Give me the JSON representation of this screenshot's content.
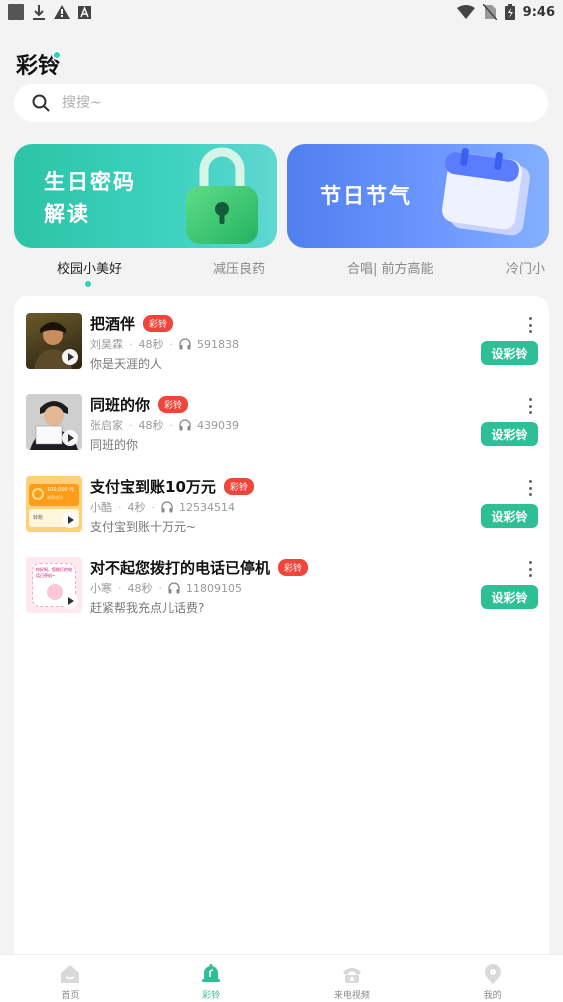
{
  "status_bar": {
    "time": "9:46",
    "left_icons": [
      "app-icon",
      "download-icon",
      "warning-icon",
      "a-icon"
    ],
    "right_icons": [
      "wifi-icon",
      "no-sim-icon",
      "battery-icon"
    ]
  },
  "header": {
    "title": "彩铃"
  },
  "search": {
    "placeholder": "搜搜~",
    "icon": "search-icon"
  },
  "banners": [
    {
      "text_line1": "生日密码",
      "text_line2": "解读",
      "icon": "lock-icon",
      "color": "#2cc4a6"
    },
    {
      "text_line1": "节日节气",
      "icon": "calendar-icon",
      "color": "#5a8df6"
    }
  ],
  "tabs": [
    {
      "label": "校园小美好",
      "active": true
    },
    {
      "label": "减压良药",
      "active": false
    },
    {
      "label": "合唱| 前方高能",
      "active": false
    },
    {
      "label": "冷门小",
      "active": false
    }
  ],
  "songs": [
    {
      "title": "把酒伴",
      "badge": "彩铃",
      "artist": "刘昊霖",
      "duration": "48秒",
      "plays": "591838",
      "description": "你是天涯的人",
      "button": "设彩铃"
    },
    {
      "title": "同班的你",
      "badge": "彩铃",
      "artist": "张启家",
      "duration": "48秒",
      "plays": "439039",
      "description": "同班的你",
      "button": "设彩铃"
    },
    {
      "title": "支付宝到账10万元",
      "badge": "彩铃",
      "artist": "小酷",
      "duration": "4秒",
      "plays": "12534514",
      "description": "支付宝到账十万元~",
      "button": "设彩铃",
      "thumb_text": "100,000 元",
      "thumb_sub": "收款成功",
      "thumb_corner": "转账"
    },
    {
      "title": "对不起您拨打的电话已停机",
      "badge": "彩铃",
      "artist": "小寒",
      "duration": "48秒",
      "plays": "11809105",
      "description": "赶紧帮我充点儿话费?",
      "button": "设彩铃",
      "thumb_text": "你好呀，您拨打的电话已停机~"
    }
  ],
  "bottom_nav": [
    {
      "label": "首页",
      "icon": "home-icon",
      "active": false
    },
    {
      "label": "彩铃",
      "icon": "bell-icon",
      "active": true
    },
    {
      "label": "来电视频",
      "icon": "phone-icon",
      "active": false
    },
    {
      "label": "我的",
      "icon": "profile-icon",
      "active": false
    }
  ],
  "colors": {
    "accent": "#2ebf97",
    "badge": "#f0453a",
    "background": "#f3f3f3"
  }
}
